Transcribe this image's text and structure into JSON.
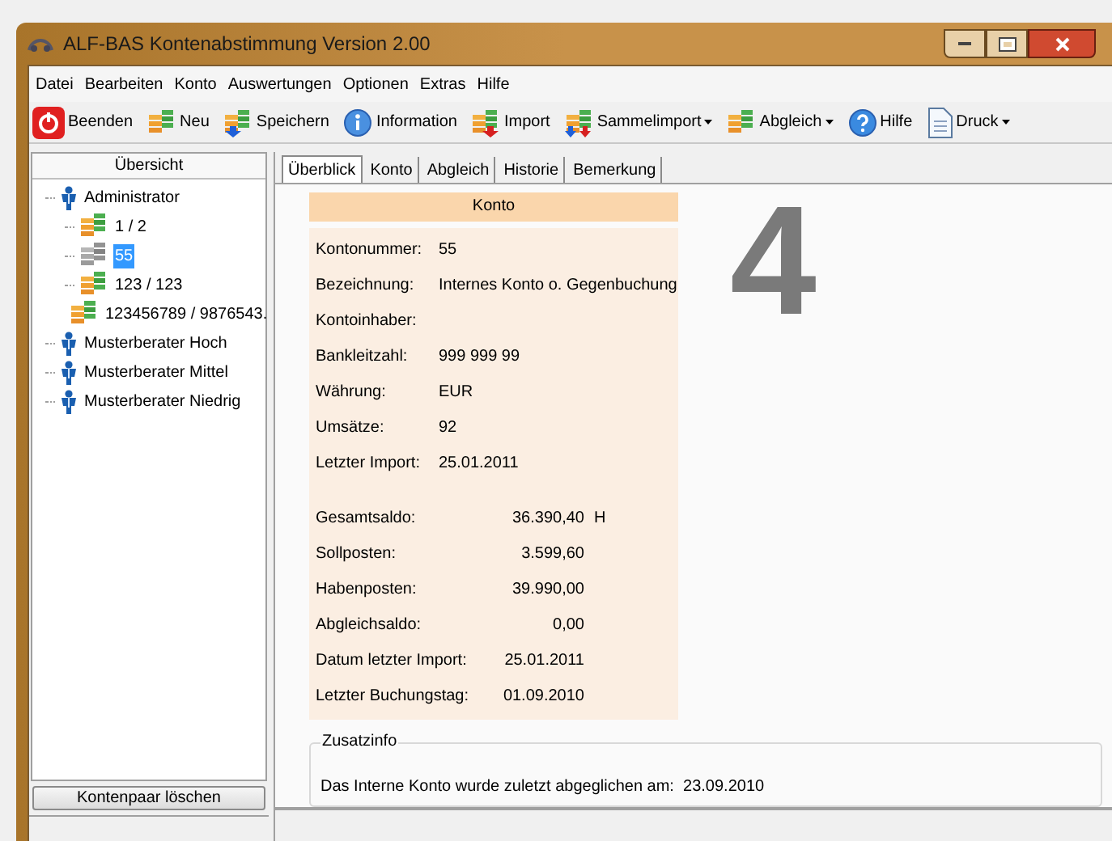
{
  "window": {
    "title": "ALF-BAS Kontenabstimmung Version 2.00"
  },
  "menu": [
    "Datei",
    "Bearbeiten",
    "Konto",
    "Auswertungen",
    "Optionen",
    "Extras",
    "Hilfe"
  ],
  "toolbar": [
    {
      "label": "Beenden",
      "kind": "power",
      "dropdown": false
    },
    {
      "label": "Neu",
      "kind": "stack",
      "dropdown": false
    },
    {
      "label": "Speichern",
      "kind": "save",
      "dropdown": false
    },
    {
      "label": "Information",
      "kind": "info",
      "dropdown": false
    },
    {
      "label": "Import",
      "kind": "import",
      "dropdown": false
    },
    {
      "label": "Sammelimport",
      "kind": "multi",
      "dropdown": true
    },
    {
      "label": "Abgleich",
      "kind": "stack",
      "dropdown": true
    },
    {
      "label": "Hilfe",
      "kind": "help",
      "dropdown": false
    },
    {
      "label": "Druck",
      "kind": "doc",
      "dropdown": true
    }
  ],
  "sidebar": {
    "title": "Übersicht",
    "tree": [
      {
        "label": "Administrator",
        "kind": "user",
        "selected": false,
        "children": [
          {
            "label": "1 / 2",
            "kind": "account",
            "selected": false
          },
          {
            "label": "55",
            "kind": "account",
            "selected": true
          },
          {
            "label": "123 / 123",
            "kind": "account",
            "selected": false
          },
          {
            "label": "123456789 / 9876543.",
            "kind": "account",
            "selected": false
          }
        ]
      },
      {
        "label": "Musterberater Hoch",
        "kind": "user",
        "selected": false
      },
      {
        "label": "Musterberater Mittel",
        "kind": "user",
        "selected": false
      },
      {
        "label": "Musterberater Niedrig",
        "kind": "user",
        "selected": false
      }
    ],
    "button": "Kontenpaar löschen"
  },
  "tabs": [
    {
      "label": "Überblick",
      "selected": true
    },
    {
      "label": "Konto",
      "selected": false
    },
    {
      "label": "Abgleich",
      "selected": false
    },
    {
      "label": "Historie",
      "selected": false
    },
    {
      "label": "Bemerkung",
      "selected": false
    }
  ],
  "big_number": "4",
  "account": {
    "title": "Konto",
    "details": [
      {
        "label": "Kontonummer:",
        "value": "55"
      },
      {
        "label": "Bezeichnung:",
        "value": "Internes Konto o. Gegenbuchung"
      },
      {
        "label": "Kontoinhaber:"
      },
      {
        "label": "Bankleitzahl:",
        "value": "999 999 99"
      },
      {
        "label": "Währung:",
        "value": "EUR"
      },
      {
        "label": "Umsätze:",
        "value": "92"
      },
      {
        "label": "Letzter Import:",
        "value": "25.01.2011"
      }
    ],
    "amounts": [
      {
        "label": "Gesamtsaldo:",
        "value": "36.390,40",
        "suffix": "H"
      },
      {
        "label": "Sollposten:",
        "value": "3.599,60"
      },
      {
        "label": "Habenposten:",
        "value": "39.990,00"
      },
      {
        "label": "Abgleichsaldo:",
        "value": "0,00"
      },
      {
        "label": "Datum letzter Import:",
        "value": "25.01.2011"
      },
      {
        "label": "Letzter Buchungstag:",
        "value": "01.09.2010"
      }
    ]
  },
  "extra_info": {
    "title": "Zusatzinfo",
    "text": "Das Interne Konto wurde zuletzt abgeglichen am:  23.09.2010"
  }
}
